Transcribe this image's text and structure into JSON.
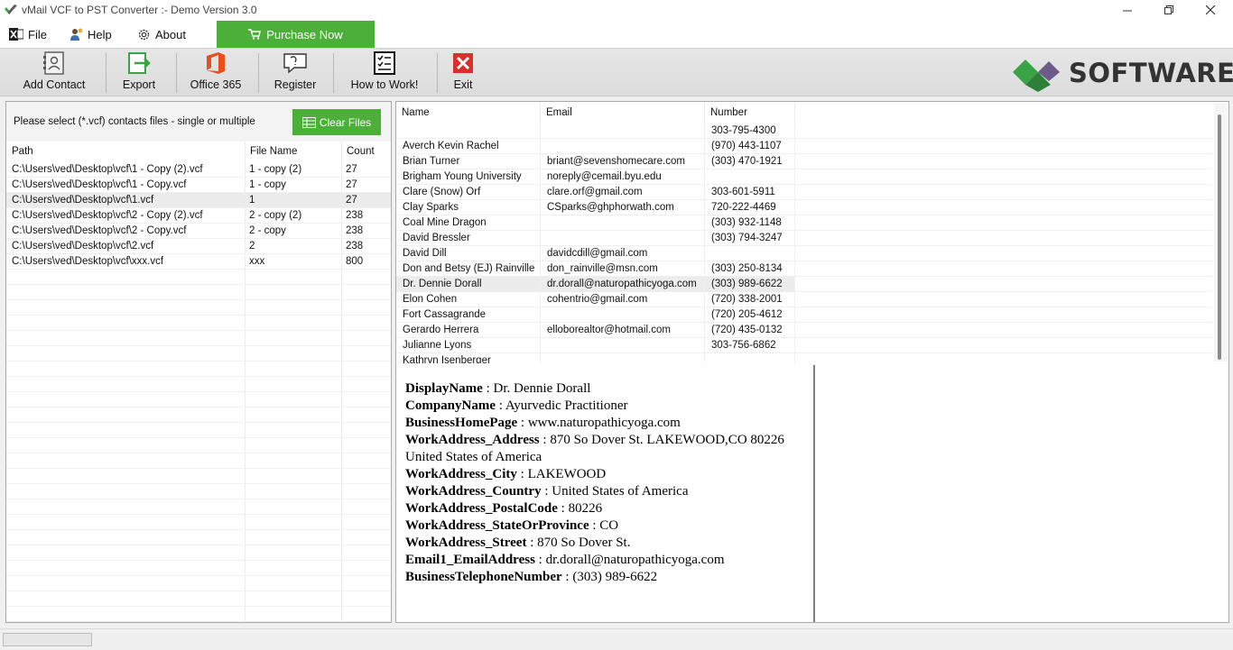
{
  "window": {
    "title": "vMail VCF to PST Converter :- Demo Version 3.0",
    "controls": [
      "minimize",
      "restore",
      "close"
    ]
  },
  "menu": {
    "file": "File",
    "help": "Help",
    "about": "About",
    "purchase": "Purchase Now"
  },
  "toolbar": {
    "add_contact": "Add Contact",
    "export": "Export",
    "office365": "Office 365",
    "register": "Register",
    "how_to_work": "How to Work!",
    "exit": "Exit"
  },
  "brand": {
    "text": "SOFTWARE"
  },
  "files_panel": {
    "note": "Please select (*.vcf) contacts files - single or multiple",
    "clear_label": "Clear Files",
    "columns": [
      "Path",
      "File Name",
      "Count"
    ],
    "rows": [
      {
        "path": "C:\\Users\\ved\\Desktop\\vcf\\1 - Copy (2).vcf",
        "name": "1 - copy (2)",
        "count": "27"
      },
      {
        "path": "C:\\Users\\ved\\Desktop\\vcf\\1 - Copy.vcf",
        "name": "1 - copy",
        "count": "27"
      },
      {
        "path": "C:\\Users\\ved\\Desktop\\vcf\\1.vcf",
        "name": "1",
        "count": "27"
      },
      {
        "path": "C:\\Users\\ved\\Desktop\\vcf\\2 - Copy (2).vcf",
        "name": "2 - copy (2)",
        "count": "238"
      },
      {
        "path": "C:\\Users\\ved\\Desktop\\vcf\\2 - Copy.vcf",
        "name": "2 - copy",
        "count": "238"
      },
      {
        "path": "C:\\Users\\ved\\Desktop\\vcf\\2.vcf",
        "name": "2",
        "count": "238"
      },
      {
        "path": "C:\\Users\\ved\\Desktop\\vcf\\xxx.vcf",
        "name": "xxx",
        "count": "800"
      }
    ],
    "selected_row": 2
  },
  "contacts": {
    "columns": [
      "Name",
      "Email",
      "Number"
    ],
    "rows": [
      {
        "name": "",
        "email": "",
        "number": "303-795-4300"
      },
      {
        "name": "Averch Kevin Rachel",
        "email": "",
        "number": "(970) 443-1107"
      },
      {
        "name": "Brian Turner",
        "email": "briant@sevenshomecare.com",
        "number": "(303) 470-1921"
      },
      {
        "name": "Brigham Young University",
        "email": "noreply@cemail.byu.edu",
        "number": ""
      },
      {
        "name": "Clare (Snow) Orf",
        "email": "clare.orf@gmail.com",
        "number": "303-601-5911"
      },
      {
        "name": "Clay Sparks",
        "email": "CSparks@ghphorwath.com",
        "number": "720-222-4469"
      },
      {
        "name": "Coal Mine Dragon",
        "email": "",
        "number": "(303) 932-1148"
      },
      {
        "name": "David Bressler",
        "email": "",
        "number": "(303) 794-3247"
      },
      {
        "name": "David Dill",
        "email": "davidcdill@gmail.com",
        "number": ""
      },
      {
        "name": "Don and Betsy (EJ) Rainville",
        "email": "don_rainville@msn.com",
        "number": "(303) 250-8134"
      },
      {
        "name": "Dr. Dennie Dorall",
        "email": "dr.dorall@naturopathicyoga.com",
        "number": "(303) 989-6622"
      },
      {
        "name": "Elon Cohen",
        "email": "cohentrio@gmail.com",
        "number": "(720) 338-2001"
      },
      {
        "name": "Fort Cassagrande",
        "email": "",
        "number": "(720) 205-4612"
      },
      {
        "name": "Gerardo Herrera",
        "email": "elloborealtor@hotmail.com",
        "number": "(720) 435-0132"
      },
      {
        "name": "Julianne  Lyons",
        "email": "",
        "number": "303-756-6862"
      },
      {
        "name": "Kathryn Isenberger",
        "email": "",
        "number": ""
      }
    ],
    "selected_row": 10
  },
  "detail": [
    {
      "key": "DisplayName",
      "value": "Dr. Dennie Dorall"
    },
    {
      "key": "CompanyName",
      "value": "Ayurvedic Practitioner"
    },
    {
      "key": "BusinessHomePage",
      "value": "www.naturopathicyoga.com"
    },
    {
      "key": "WorkAddress_Address",
      "value": "870 So Dover St. LAKEWOOD,CO 80226 United States of America"
    },
    {
      "key": "WorkAddress_City",
      "value": "LAKEWOOD"
    },
    {
      "key": "WorkAddress_Country",
      "value": "United States of America"
    },
    {
      "key": "WorkAddress_PostalCode",
      "value": "80226"
    },
    {
      "key": "WorkAddress_StateOrProvince",
      "value": "CO"
    },
    {
      "key": "WorkAddress_Street",
      "value": "870 So Dover St."
    },
    {
      "key": "Email1_EmailAddress",
      "value": "dr.dorall@naturopathicyoga.com"
    },
    {
      "key": "BusinessTelephoneNumber",
      "value": "(303) 989-6622"
    }
  ],
  "colors": {
    "accent_green": "#4caf3a",
    "exit_red": "#d9302c",
    "office_orange": "#e94e1b"
  }
}
